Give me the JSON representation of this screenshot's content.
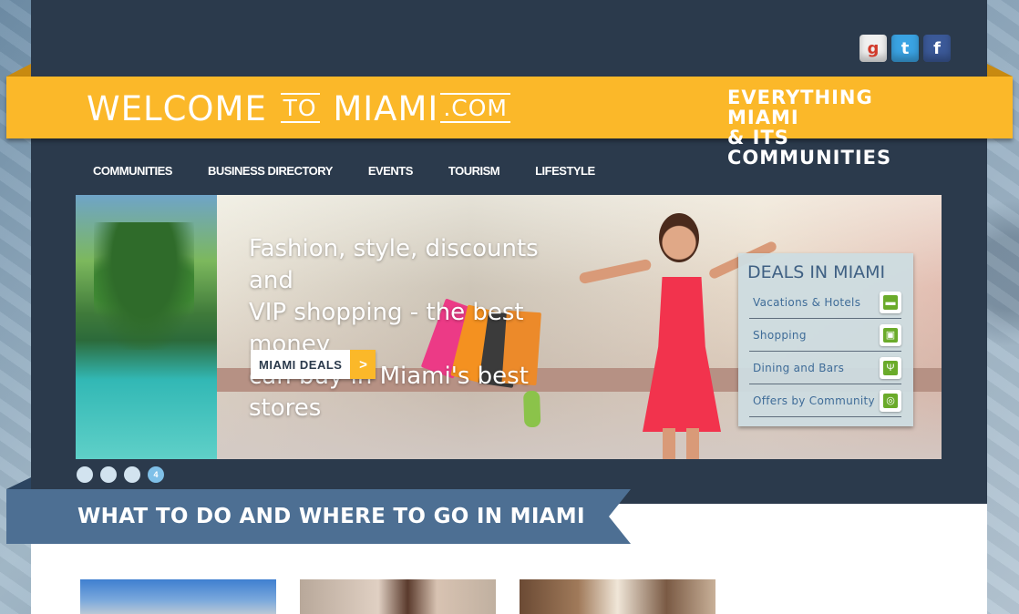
{
  "social": {
    "google": "g",
    "twitter": "t",
    "facebook": "f"
  },
  "header": {
    "logo_part1": "WELCOME",
    "logo_part2": "TO",
    "logo_part3": "MIAMI",
    "logo_part4": ".COM",
    "tagline_line1": "EVERYTHING MIAMI",
    "tagline_line2": "& ITS COMMUNITIES"
  },
  "nav": {
    "items": [
      "COMMUNITIES",
      "BUSINESS DIRECTORY",
      "EVENTS",
      "TOURISM",
      "LIFESTYLE"
    ]
  },
  "hero": {
    "headline_line1": "Fashion, style, discounts and",
    "headline_line2": "VIP shopping - the best money",
    "headline_line3": "can buy in Miami's best stores",
    "button_label": "MIAMI DEALS",
    "button_arrow": ">"
  },
  "deals": {
    "title": "DEALS IN MIAMI",
    "items": [
      {
        "label": "Vacations & Hotels",
        "icon": "bed-icon"
      },
      {
        "label": "Shopping",
        "icon": "bag-icon"
      },
      {
        "label": "Dining and Bars",
        "icon": "fork-knife-icon"
      },
      {
        "label": "Offers by Community",
        "icon": "lightbulb-icon"
      }
    ]
  },
  "slider": {
    "active_label": "4"
  },
  "section": {
    "title": "WHAT TO DO AND WHERE TO GO IN MIAMI"
  },
  "colors": {
    "navy": "#2b3a4c",
    "yellow": "#fbb829",
    "ribbon_blue": "#4d6f93",
    "green_icon": "#6aab2a"
  }
}
